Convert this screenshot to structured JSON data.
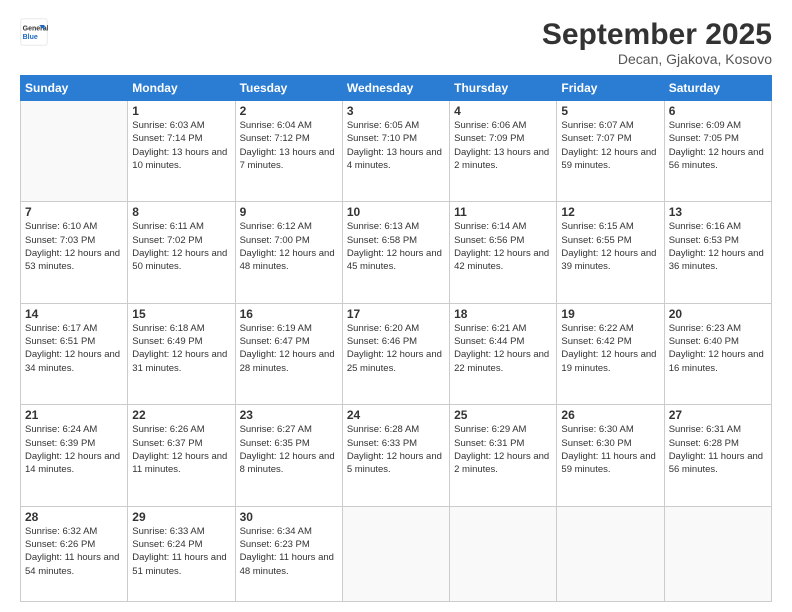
{
  "header": {
    "logo": {
      "general": "General",
      "blue": "Blue"
    },
    "month": "September 2025",
    "location": "Decan, Gjakova, Kosovo"
  },
  "weekdays": [
    "Sunday",
    "Monday",
    "Tuesday",
    "Wednesday",
    "Thursday",
    "Friday",
    "Saturday"
  ],
  "weeks": [
    [
      {
        "day": null
      },
      {
        "day": 1,
        "sunrise": "6:03 AM",
        "sunset": "7:14 PM",
        "daylight": "13 hours and 10 minutes."
      },
      {
        "day": 2,
        "sunrise": "6:04 AM",
        "sunset": "7:12 PM",
        "daylight": "13 hours and 7 minutes."
      },
      {
        "day": 3,
        "sunrise": "6:05 AM",
        "sunset": "7:10 PM",
        "daylight": "13 hours and 4 minutes."
      },
      {
        "day": 4,
        "sunrise": "6:06 AM",
        "sunset": "7:09 PM",
        "daylight": "13 hours and 2 minutes."
      },
      {
        "day": 5,
        "sunrise": "6:07 AM",
        "sunset": "7:07 PM",
        "daylight": "12 hours and 59 minutes."
      },
      {
        "day": 6,
        "sunrise": "6:09 AM",
        "sunset": "7:05 PM",
        "daylight": "12 hours and 56 minutes."
      }
    ],
    [
      {
        "day": 7,
        "sunrise": "6:10 AM",
        "sunset": "7:03 PM",
        "daylight": "12 hours and 53 minutes."
      },
      {
        "day": 8,
        "sunrise": "6:11 AM",
        "sunset": "7:02 PM",
        "daylight": "12 hours and 50 minutes."
      },
      {
        "day": 9,
        "sunrise": "6:12 AM",
        "sunset": "7:00 PM",
        "daylight": "12 hours and 48 minutes."
      },
      {
        "day": 10,
        "sunrise": "6:13 AM",
        "sunset": "6:58 PM",
        "daylight": "12 hours and 45 minutes."
      },
      {
        "day": 11,
        "sunrise": "6:14 AM",
        "sunset": "6:56 PM",
        "daylight": "12 hours and 42 minutes."
      },
      {
        "day": 12,
        "sunrise": "6:15 AM",
        "sunset": "6:55 PM",
        "daylight": "12 hours and 39 minutes."
      },
      {
        "day": 13,
        "sunrise": "6:16 AM",
        "sunset": "6:53 PM",
        "daylight": "12 hours and 36 minutes."
      }
    ],
    [
      {
        "day": 14,
        "sunrise": "6:17 AM",
        "sunset": "6:51 PM",
        "daylight": "12 hours and 34 minutes."
      },
      {
        "day": 15,
        "sunrise": "6:18 AM",
        "sunset": "6:49 PM",
        "daylight": "12 hours and 31 minutes."
      },
      {
        "day": 16,
        "sunrise": "6:19 AM",
        "sunset": "6:47 PM",
        "daylight": "12 hours and 28 minutes."
      },
      {
        "day": 17,
        "sunrise": "6:20 AM",
        "sunset": "6:46 PM",
        "daylight": "12 hours and 25 minutes."
      },
      {
        "day": 18,
        "sunrise": "6:21 AM",
        "sunset": "6:44 PM",
        "daylight": "12 hours and 22 minutes."
      },
      {
        "day": 19,
        "sunrise": "6:22 AM",
        "sunset": "6:42 PM",
        "daylight": "12 hours and 19 minutes."
      },
      {
        "day": 20,
        "sunrise": "6:23 AM",
        "sunset": "6:40 PM",
        "daylight": "12 hours and 16 minutes."
      }
    ],
    [
      {
        "day": 21,
        "sunrise": "6:24 AM",
        "sunset": "6:39 PM",
        "daylight": "12 hours and 14 minutes."
      },
      {
        "day": 22,
        "sunrise": "6:26 AM",
        "sunset": "6:37 PM",
        "daylight": "12 hours and 11 minutes."
      },
      {
        "day": 23,
        "sunrise": "6:27 AM",
        "sunset": "6:35 PM",
        "daylight": "12 hours and 8 minutes."
      },
      {
        "day": 24,
        "sunrise": "6:28 AM",
        "sunset": "6:33 PM",
        "daylight": "12 hours and 5 minutes."
      },
      {
        "day": 25,
        "sunrise": "6:29 AM",
        "sunset": "6:31 PM",
        "daylight": "12 hours and 2 minutes."
      },
      {
        "day": 26,
        "sunrise": "6:30 AM",
        "sunset": "6:30 PM",
        "daylight": "11 hours and 59 minutes."
      },
      {
        "day": 27,
        "sunrise": "6:31 AM",
        "sunset": "6:28 PM",
        "daylight": "11 hours and 56 minutes."
      }
    ],
    [
      {
        "day": 28,
        "sunrise": "6:32 AM",
        "sunset": "6:26 PM",
        "daylight": "11 hours and 54 minutes."
      },
      {
        "day": 29,
        "sunrise": "6:33 AM",
        "sunset": "6:24 PM",
        "daylight": "11 hours and 51 minutes."
      },
      {
        "day": 30,
        "sunrise": "6:34 AM",
        "sunset": "6:23 PM",
        "daylight": "11 hours and 48 minutes."
      },
      {
        "day": null
      },
      {
        "day": null
      },
      {
        "day": null
      },
      {
        "day": null
      }
    ]
  ]
}
